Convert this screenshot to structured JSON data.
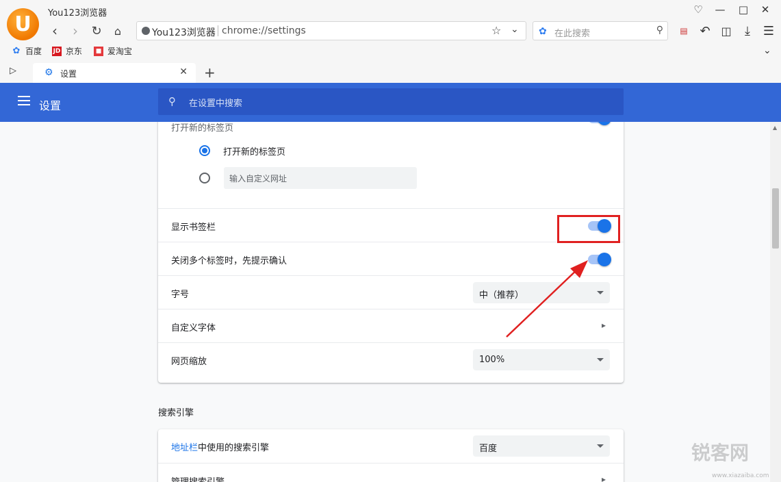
{
  "window": {
    "app_title": "You123浏览器"
  },
  "addressbar": {
    "site": "You123浏览器",
    "url": "chrome://settings"
  },
  "search": {
    "placeholder": "在此搜索"
  },
  "bookmarks": [
    {
      "label": "百度"
    },
    {
      "label": "京东"
    },
    {
      "label": "爱淘宝"
    }
  ],
  "tab": {
    "title": "设置"
  },
  "settings_header": {
    "title": "设置",
    "search_placeholder": "在设置中搜索"
  },
  "appearance": {
    "new_tab_heading": "打开新的标签页",
    "radio_new_tab": "打开新的标签页",
    "custom_url_placeholder": "输入自定义网址",
    "show_bookmarks_bar": "显示书签栏",
    "confirm_close_tabs": "关闭多个标签时，先提示确认",
    "font_size_label": "字号",
    "font_size_value": "中（推荐）",
    "custom_fonts": "自定义字体",
    "page_zoom_label": "网页缩放",
    "page_zoom_value": "100%"
  },
  "search_engine": {
    "section_title": "搜索引擎",
    "addressbar_link": "地址栏",
    "engine_label_rest": "中使用的搜索引擎",
    "engine_value": "百度",
    "manage": "管理搜索引擎"
  },
  "toggles": {
    "show_bookmarks_bar": true,
    "confirm_close_tabs": true
  },
  "colors": {
    "header_blue": "#3367d6",
    "toggle_blue": "#1a73e8",
    "highlight_red": "#e02020"
  },
  "watermark": {
    "brand": "锐客网",
    "url": "www.xiazaiba.com"
  }
}
